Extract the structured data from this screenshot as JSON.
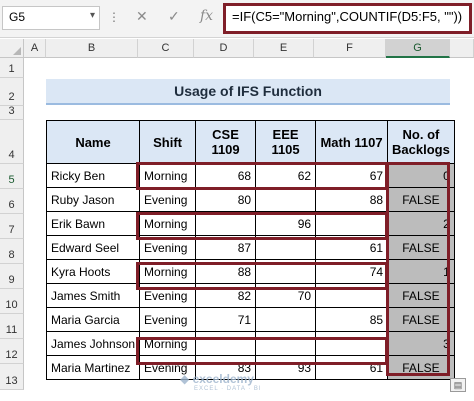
{
  "formula_bar": {
    "cell_ref": "G5",
    "formula": "=IF(C5=\"Morning\",COUNTIF(D5:F5, \"\"))"
  },
  "columns": [
    "A",
    "B",
    "C",
    "D",
    "E",
    "F",
    "G"
  ],
  "rows": [
    "1",
    "2",
    "3",
    "4",
    "5",
    "6",
    "7",
    "8",
    "9",
    "10",
    "11",
    "12",
    "13"
  ],
  "title": "Usage of IFS Function",
  "table": {
    "headers": [
      "Name",
      "Shift",
      "CSE 1109",
      "EEE 1105",
      "Math 1107",
      "No. of Backlogs"
    ],
    "rows": [
      [
        "Ricky Ben",
        "Morning",
        "68",
        "62",
        "67",
        "0"
      ],
      [
        "Ruby Jason",
        "Evening",
        "80",
        "",
        "88",
        "FALSE"
      ],
      [
        "Erik Bawn",
        "Morning",
        "",
        "96",
        "",
        "2"
      ],
      [
        "Edward Seel",
        "Evening",
        "87",
        "",
        "61",
        "FALSE"
      ],
      [
        "Kyra Hoots",
        "Morning",
        "88",
        "",
        "74",
        "1"
      ],
      [
        "James Smith",
        "Evening",
        "82",
        "70",
        "",
        "FALSE"
      ],
      [
        "Maria Garcia",
        "Evening",
        "71",
        "",
        "85",
        "FALSE"
      ],
      [
        "James Johnson",
        "Morning",
        "",
        "",
        "",
        "3"
      ],
      [
        "Maria Martinez",
        "Evening",
        "83",
        "93",
        "61",
        "FALSE"
      ]
    ]
  },
  "watermark": {
    "brand": "exceldemy",
    "tagline": "EXCEL · DATA · BI"
  },
  "accent_color": "#7f1e28",
  "header_fill": "#dbe7f5"
}
